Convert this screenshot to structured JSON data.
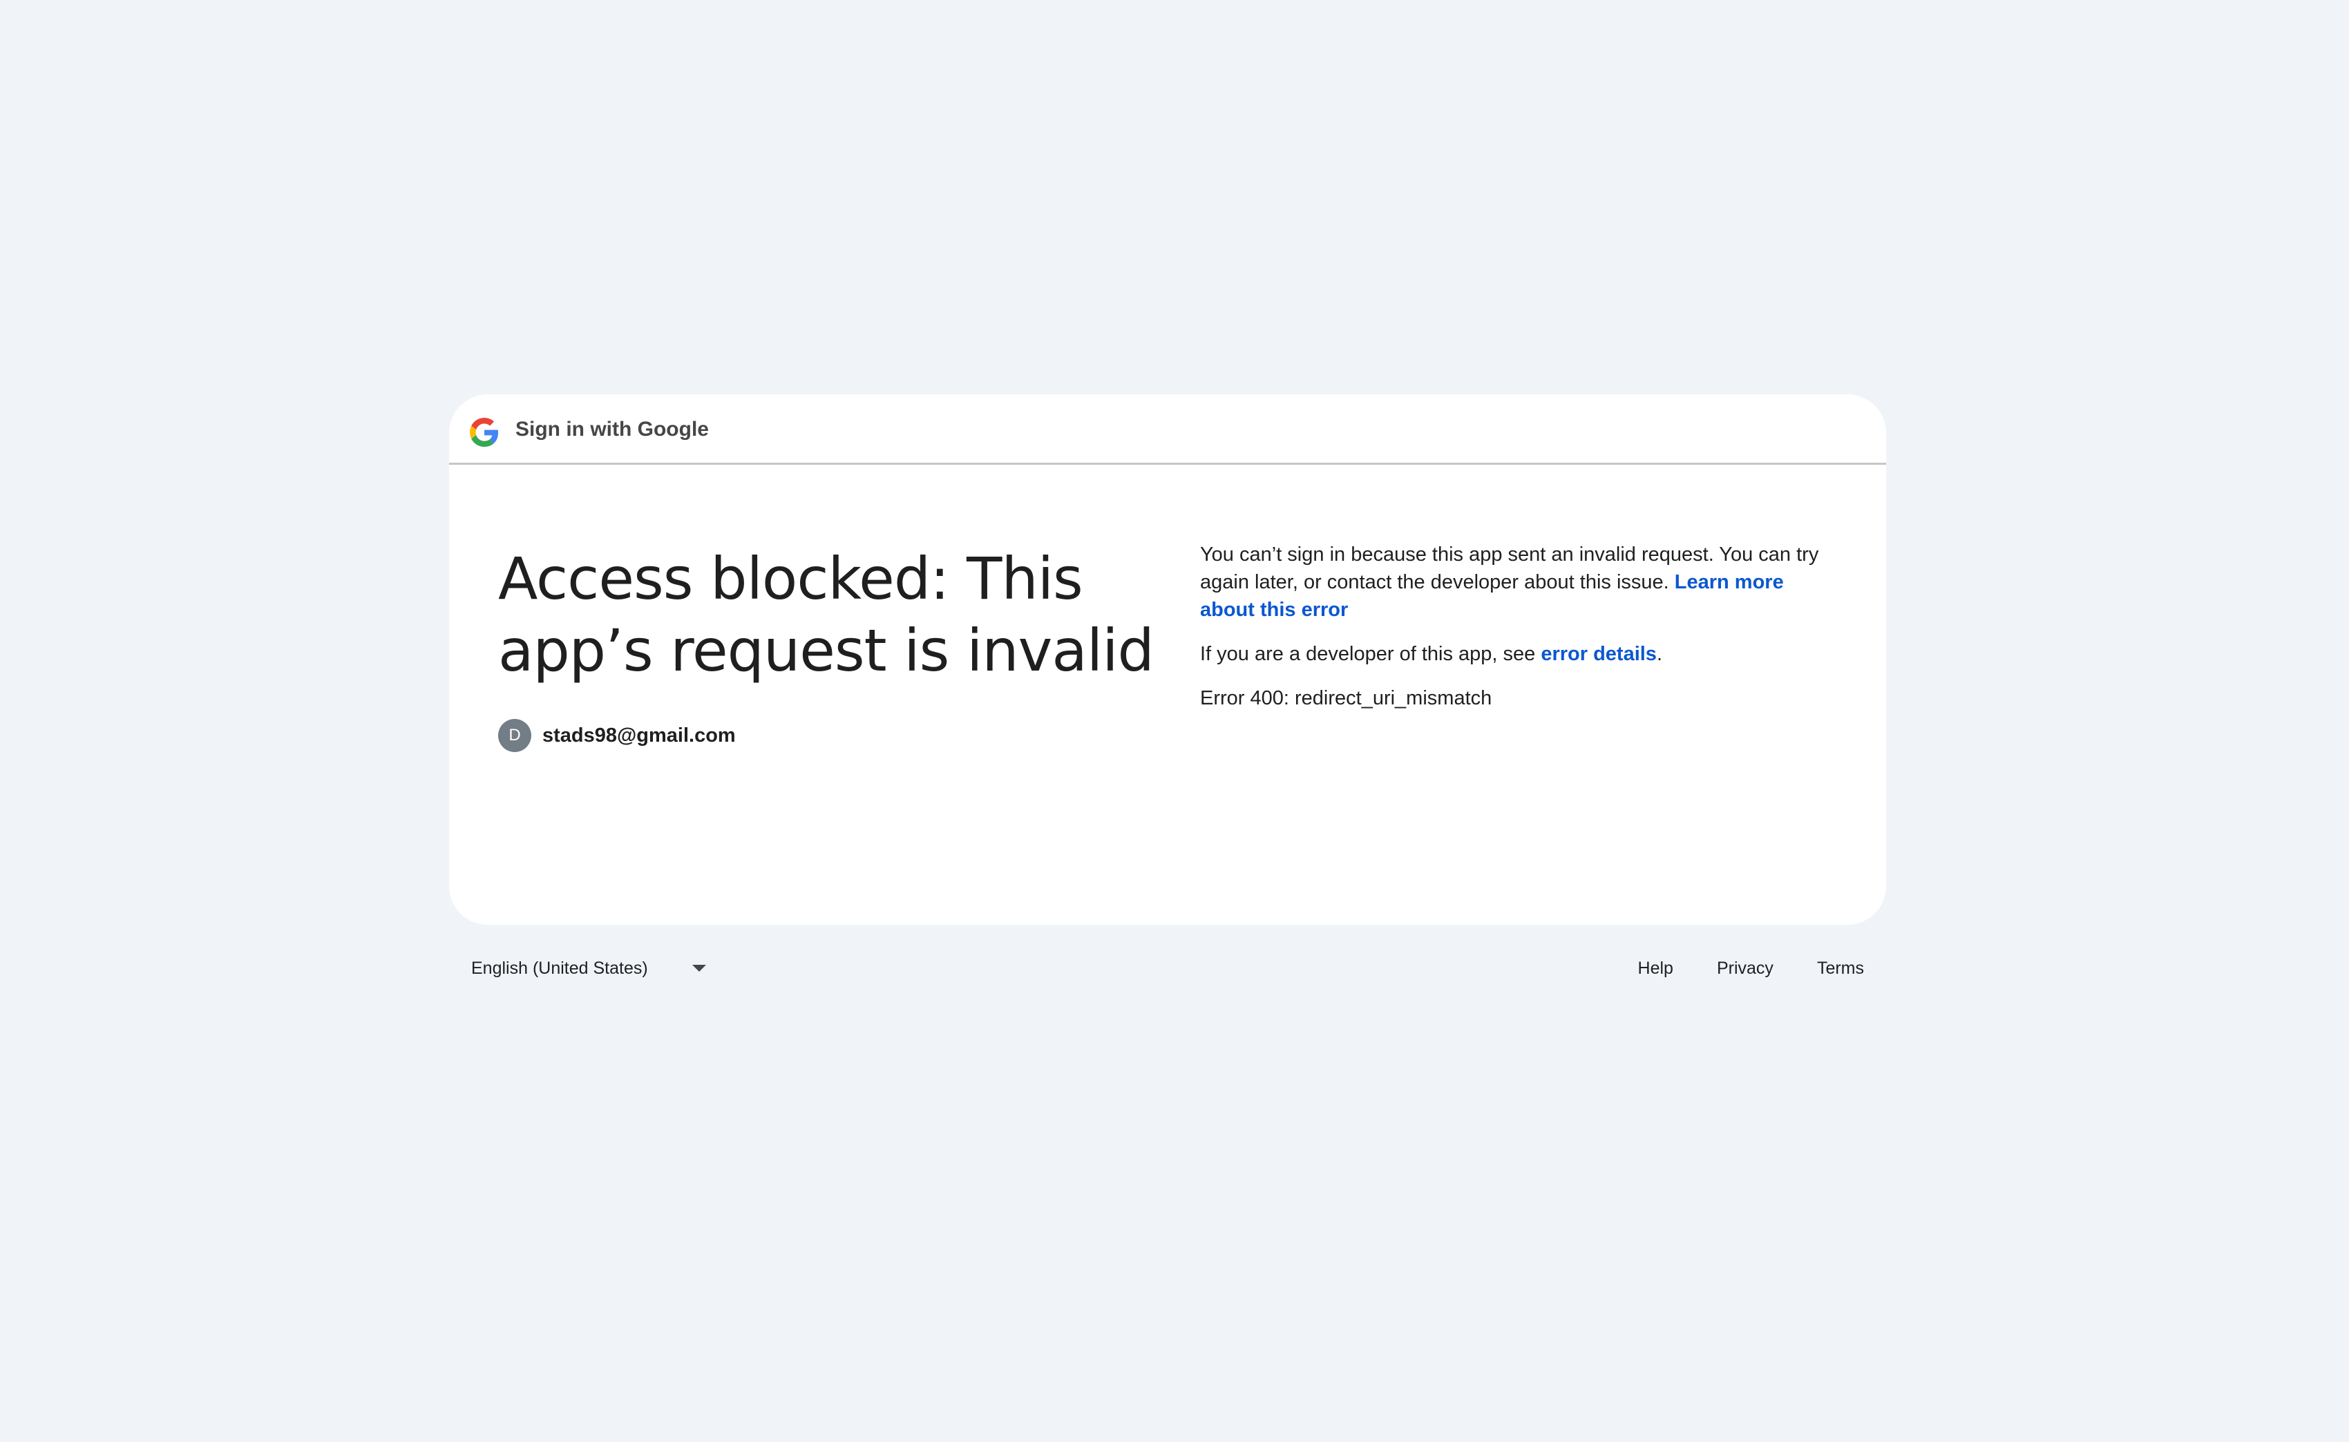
{
  "header": {
    "title": "Sign in with Google",
    "logo": "google-g-logo"
  },
  "main": {
    "headline": "Access blocked: This app’s request is invalid",
    "account": {
      "initial": "D",
      "email": "stads98@gmail.com",
      "avatar_color": "#727d86"
    },
    "message": {
      "text": "You can’t sign in because this app sent an invalid request. You can try again later, or contact the developer about this issue.",
      "learn_more_link": "Learn more about this error"
    },
    "developer": {
      "prefix": "If you are a developer of this app, see ",
      "link": "error details",
      "suffix": "."
    },
    "error_code": "Error 400: redirect_uri_mismatch"
  },
  "footer": {
    "language": "English (United States)",
    "links": {
      "help": "Help",
      "privacy": "Privacy",
      "terms": "Terms"
    }
  },
  "colors": {
    "background": "#f0f4f9",
    "card": "#ffffff",
    "link": "#0b57d0",
    "text": "#1f1f1f"
  }
}
